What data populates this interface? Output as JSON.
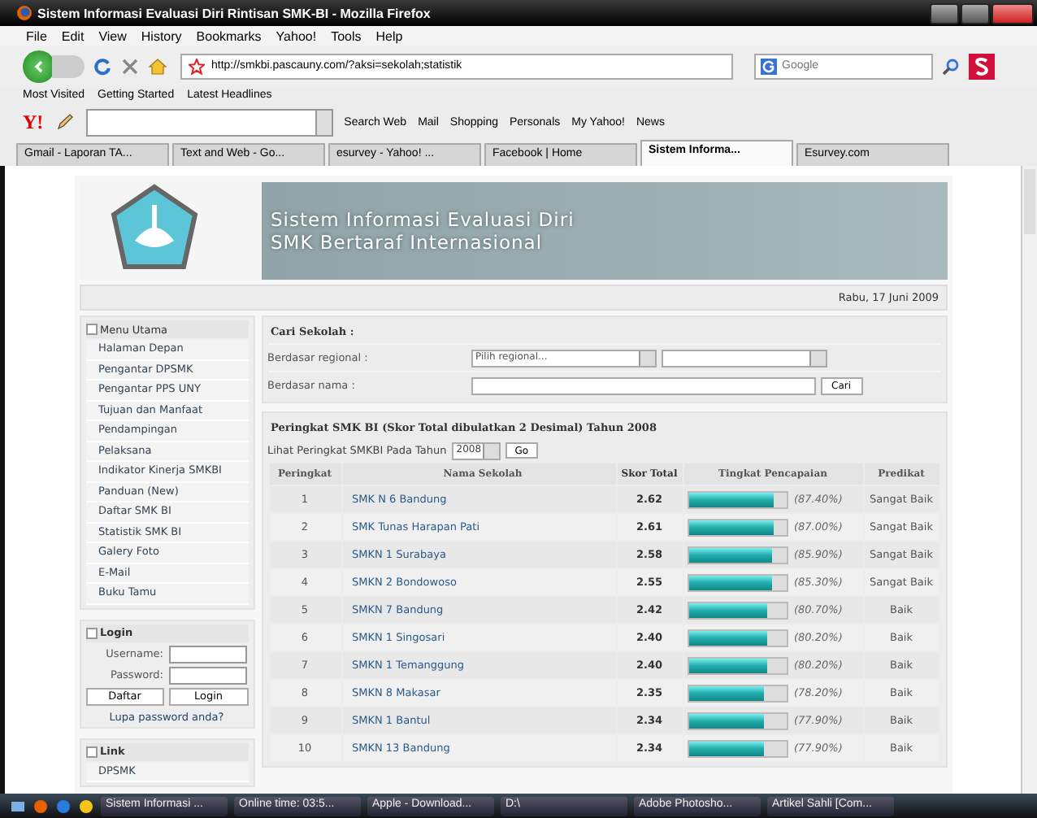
{
  "window": {
    "title": "Sistem Informasi Evaluasi Diri Rintisan SMK-BI - Mozilla Firefox"
  },
  "menu": [
    "File",
    "Edit",
    "View",
    "History",
    "Bookmarks",
    "Yahoo!",
    "Tools",
    "Help"
  ],
  "nav": {
    "url": "http://smkbi.pascauny.com/?aksi=sekolah;statistik",
    "search_placeholder": "Google"
  },
  "bookmarks": [
    "Most Visited",
    "Getting Started",
    "Latest Headlines"
  ],
  "yahoo_logo": "Y!",
  "yahoo_toolbar": [
    "Search Web",
    "Mail",
    "Shopping",
    "Personals",
    "My Yahoo!",
    "News"
  ],
  "tabs": [
    {
      "label": "Gmail - Laporan TA...",
      "selected": false
    },
    {
      "label": "Text and Web - Go...",
      "selected": false
    },
    {
      "label": "esurvey - Yahoo! ...",
      "selected": false
    },
    {
      "label": "Facebook | Home",
      "selected": false
    },
    {
      "label": "Sistem Informa...",
      "selected": true
    },
    {
      "label": "Esurvey.com",
      "selected": false
    }
  ],
  "page": {
    "banner": [
      "Sistem Informasi Evaluasi Diri",
      "SMK Bertaraf Internasional"
    ],
    "date": "Rabu, 17 Juni 2009",
    "sidebar": {
      "menu_title": "Menu Utama",
      "items": [
        "Halaman Depan",
        "Pengantar DPSMK",
        "Pengantar PPS UNY",
        "Tujuan dan Manfaat",
        "Pendampingan",
        "Pelaksana",
        "Indikator Kinerja SMKBI",
        "Panduan (New)",
        "Daftar SMK BI",
        "Statistik SMK BI",
        "Galery Foto",
        "E-Mail",
        "Buku Tamu"
      ],
      "login": {
        "title": "Login",
        "username_label": "Username:",
        "password_label": "Password:",
        "buttons": [
          "Daftar",
          "Login"
        ],
        "forgot_link": "Lupa password anda?"
      },
      "links": {
        "title": "Link",
        "items": [
          "DPSMK"
        ]
      }
    },
    "search": {
      "title": "Cari Sekolah :",
      "regional_label": "Berdasar regional :",
      "regional_placeholder": "Pilih regional...",
      "name_label": "Berdasar nama :",
      "button": "Cari"
    },
    "ranking": {
      "title": "Peringkat SMK BI (Skor Total dibulatkan 2 Desimal) Tahun 2008",
      "year_label": "Lihat Peringkat SMKBI Pada Tahun",
      "year": "2008",
      "go": "Go",
      "columns": [
        "Peringkat",
        "Nama Sekolah",
        "Skor Total",
        "Tingkat Pencapaian",
        "Predikat"
      ],
      "rows": [
        {
          "rank": "1",
          "name": "SMK N 6 Bandung",
          "score": "2.62",
          "level": 0.874,
          "percent": "(87.40%)",
          "predikat": "Sangat Baik"
        },
        {
          "rank": "2",
          "name": "SMK Tunas Harapan Pati",
          "score": "2.61",
          "level": 0.87,
          "percent": "(87.00%)",
          "predikat": "Sangat Baik"
        },
        {
          "rank": "3",
          "name": "SMKN 1 Surabaya",
          "score": "2.58",
          "level": 0.859,
          "percent": "(85.90%)",
          "predikat": "Sangat Baik"
        },
        {
          "rank": "4",
          "name": "SMKN 2 Bondowoso",
          "score": "2.55",
          "level": 0.853,
          "percent": "(85.30%)",
          "predikat": "Sangat Baik"
        },
        {
          "rank": "5",
          "name": "SMKN 7 Bandung",
          "score": "2.42",
          "level": 0.807,
          "percent": "(80.70%)",
          "predikat": "Baik"
        },
        {
          "rank": "6",
          "name": "SMKN 1 Singosari",
          "score": "2.40",
          "level": 0.802,
          "percent": "(80.20%)",
          "predikat": "Baik"
        },
        {
          "rank": "7",
          "name": "SMKN 1 Temanggung",
          "score": "2.40",
          "level": 0.802,
          "percent": "(80.20%)",
          "predikat": "Baik"
        },
        {
          "rank": "8",
          "name": "SMKN 8 Makasar",
          "score": "2.35",
          "level": 0.782,
          "percent": "(78.20%)",
          "predikat": "Baik"
        },
        {
          "rank": "9",
          "name": "SMKN 1 Bantul",
          "score": "2.34",
          "level": 0.779,
          "percent": "(77.90%)",
          "predikat": "Baik"
        },
        {
          "rank": "10",
          "name": "SMKN 13 Bandung",
          "score": "2.34",
          "level": 0.779,
          "percent": "(77.90%)",
          "predikat": "Baik"
        }
      ]
    }
  },
  "taskbar": [
    "Sistem Informasi ...",
    "Online time: 03:5...",
    "Apple - Download...",
    "D:\\",
    "Adobe Photosho...",
    "Artikel Sahli [Com..."
  ]
}
